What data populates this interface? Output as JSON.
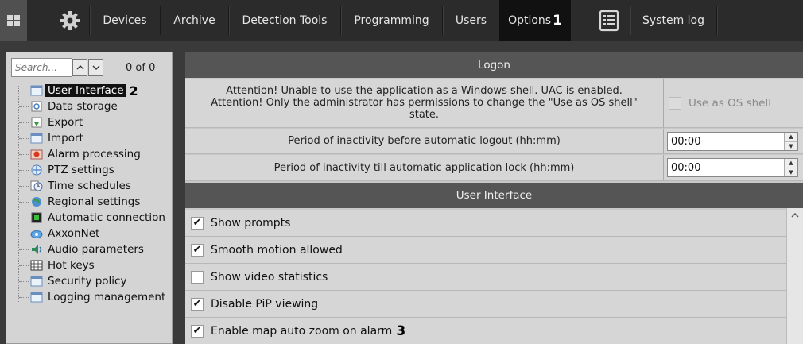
{
  "topbar": {
    "tabs": [
      {
        "label": "Devices"
      },
      {
        "label": "Archive"
      },
      {
        "label": "Detection Tools"
      },
      {
        "label": "Programming"
      },
      {
        "label": "Users"
      },
      {
        "label": "Options",
        "marker": "1"
      },
      {
        "label": "System log"
      }
    ],
    "icons": [
      "grid-icon",
      "gear-icon",
      "log-document-icon"
    ],
    "colors": {
      "bar": "#2b2b2b",
      "active_tab": "#111111",
      "text": "#e6e6e6"
    }
  },
  "left_panel": {
    "search": {
      "placeholder": "Search...",
      "value": ""
    },
    "nav_up": "^",
    "nav_down": "v",
    "match_count": "0 of 0",
    "tree": [
      {
        "label": "User Interface",
        "marker": "2",
        "selected": true,
        "icon": "window-icon"
      },
      {
        "label": "Data storage",
        "icon": "storage-icon"
      },
      {
        "label": "Export",
        "icon": "export-icon"
      },
      {
        "label": "Import",
        "icon": "window-icon"
      },
      {
        "label": "Alarm processing",
        "icon": "alarm-icon"
      },
      {
        "label": "PTZ settings",
        "icon": "ptz-icon"
      },
      {
        "label": "Time schedules",
        "icon": "clock-icon"
      },
      {
        "label": "Regional settings",
        "icon": "globe-icon"
      },
      {
        "label": "Automatic connection",
        "icon": "connection-icon"
      },
      {
        "label": "AxxonNet",
        "icon": "cloud-icon"
      },
      {
        "label": "Audio parameters",
        "icon": "audio-icon"
      },
      {
        "label": "Hot keys",
        "icon": "keyboard-icon"
      },
      {
        "label": "Security policy",
        "icon": "window-icon"
      },
      {
        "label": "Logging management",
        "icon": "window-icon"
      }
    ]
  },
  "right_panel": {
    "logon": {
      "header": "Logon",
      "warning_lines": [
        "Attention! Unable to use the application as a Windows shell. UAC is enabled.",
        "Attention! Only the administrator has permissions to change the \"Use as OS shell\"",
        "state."
      ],
      "os_shell_label": "Use as OS shell",
      "os_shell_checked": false,
      "logout_label": "Period of inactivity before automatic logout (hh:mm)",
      "logout_value": "00:00",
      "lock_label": "Period of inactivity till automatic application lock (hh:mm)",
      "lock_value": "00:00"
    },
    "user_interface": {
      "header": "User Interface",
      "options": [
        {
          "label": "Show prompts",
          "checked": true
        },
        {
          "label": "Smooth motion allowed",
          "checked": true
        },
        {
          "label": "Show video statistics",
          "checked": false
        },
        {
          "label": "Disable PiP viewing",
          "checked": true
        },
        {
          "label": "Enable map auto zoom on alarm",
          "checked": true,
          "marker": "3"
        }
      ]
    }
  }
}
